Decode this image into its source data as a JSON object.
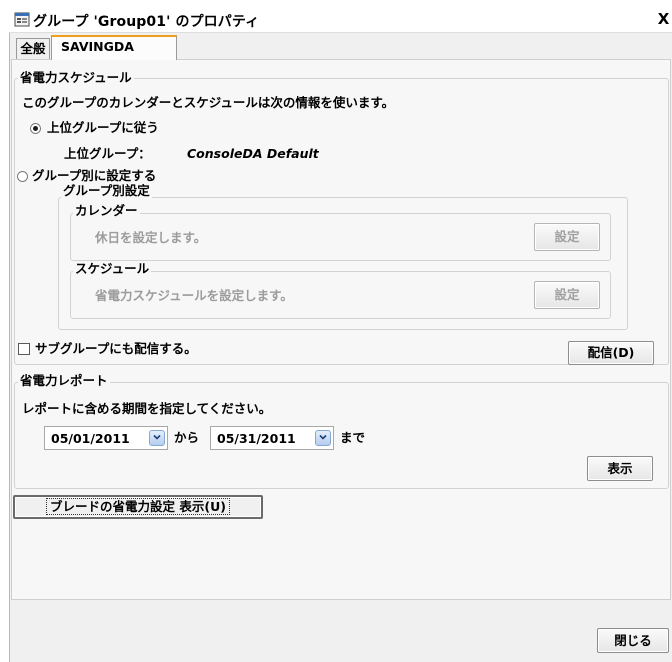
{
  "window": {
    "title": "グループ 'Group01' のプロパティ",
    "close_glyph": "X"
  },
  "tabs": [
    {
      "label": "全般",
      "active": false
    },
    {
      "label": "SAVINGDA",
      "active": true
    }
  ],
  "power_schedule": {
    "legend": "省電力スケジュール",
    "description": "このグループのカレンダーとスケジュールは次の情報を使います。",
    "option_inherit": {
      "label": "上位グループに従う",
      "selected": true
    },
    "parent_label": "上位グループ：",
    "parent_value": "ConsoleDA Default",
    "option_per_group": {
      "label": "グループ別に設定する",
      "selected": false
    },
    "group_settings": {
      "legend": "グループ別設定",
      "calendar": {
        "legend": "カレンダー",
        "text": "休日を設定します。",
        "button": "設定"
      },
      "schedule": {
        "legend": "スケジュール",
        "text": "省電力スケジュールを設定します。",
        "button": "設定"
      }
    },
    "subgroup_checkbox": {
      "label": "サブグループにも配信する。",
      "checked": false
    },
    "deliver_button": "配信(D)"
  },
  "power_report": {
    "legend": "省電力レポート",
    "description": "レポートに含める期間を指定してください。",
    "from_date": "05/01/2011",
    "from_suffix": "から",
    "to_date": "05/31/2011",
    "to_suffix": "まで",
    "show_button": "表示"
  },
  "blade_button": "ブレードの省電力設定 表示(U)",
  "close_button": "閉じる"
}
